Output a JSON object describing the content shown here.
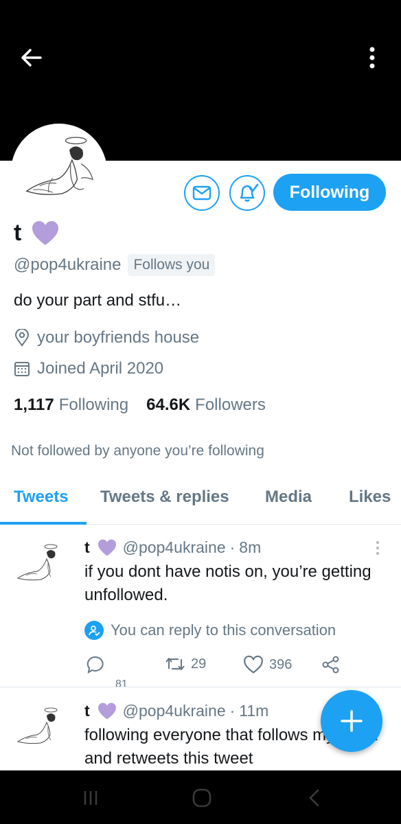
{
  "header": {
    "back_icon": "arrow-left-icon",
    "more_icon": "vertical-dots-icon"
  },
  "profile": {
    "name": "t",
    "name_emoji": "purple-heart",
    "handle": "@pop4ukraine",
    "follows_you": "Follows you",
    "bio": "do your part and stfu…",
    "location": "your boyfriends house",
    "joined": "Joined April 2020",
    "following_count": "1,117",
    "following_label": "Following",
    "followers_count": "64.6K",
    "followers_label": "Followers",
    "not_followed": "Not followed by anyone you’re following"
  },
  "actions": {
    "message_icon": "envelope-icon",
    "notify_icon": "bell-check-icon",
    "follow_label": "Following"
  },
  "tabs": [
    {
      "label": "Tweets",
      "active": true
    },
    {
      "label": "Tweets & replies",
      "active": false
    },
    {
      "label": "Media",
      "active": false
    },
    {
      "label": "Likes",
      "active": false
    }
  ],
  "tweets": [
    {
      "name": "t",
      "handle": "@pop4ukraine",
      "sep": "·",
      "time": "8m",
      "text": "if you dont have notis on, you’re getting unfollowed.",
      "reply_note": "You can reply to this conversation",
      "retweets": "29",
      "likes": "396",
      "replies": "81"
    },
    {
      "name": "t",
      "handle": "@pop4ukraine",
      "sep": "·",
      "time": "11m",
      "text": "following everyone that follows my tiktok and retweets this tweet"
    }
  ],
  "colors": {
    "accent": "#1da1f2",
    "heart": "#b39ddb",
    "muted": "#657786"
  }
}
